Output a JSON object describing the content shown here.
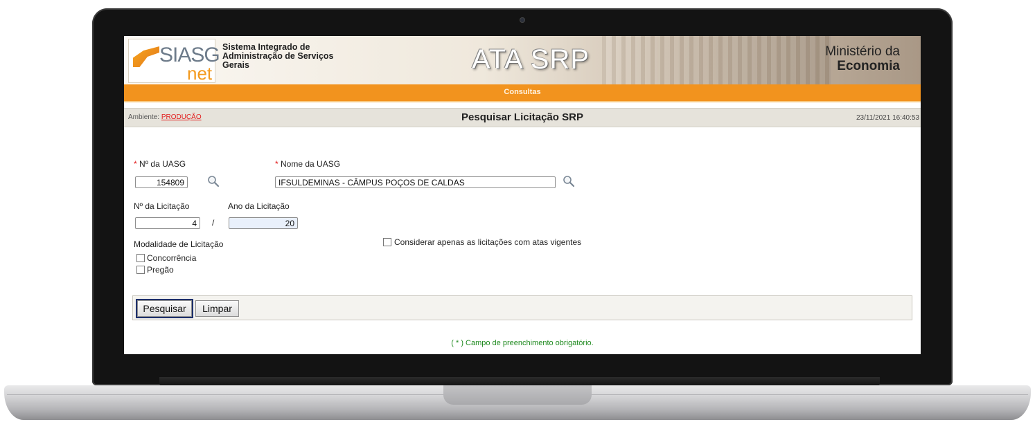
{
  "header": {
    "logo_text": "SIASG",
    "logo_sub": "net",
    "system_name": "Sistema Integrado de Administração de Serviços Gerais",
    "app_title": "ATA SRP",
    "ministry_line1": "Ministério da",
    "ministry_line2": "Economia"
  },
  "menu": {
    "item": "Consultas"
  },
  "titlebar": {
    "env_label": "Ambiente:",
    "env_value": "PRODUÇÃO",
    "page_title": "Pesquisar Licitação SRP",
    "datetime": "23/11/2021 16:40:53"
  },
  "form": {
    "required_mark": "*",
    "uasg_number_label": "Nº da UASG",
    "uasg_number_value": "154809",
    "uasg_name_label": "Nome da UASG",
    "uasg_name_value": "IFSULDEMINAS - CÂMPUS POÇOS DE CALDAS",
    "licitacao_number_label": "Nº da Licitação",
    "licitacao_number_value": "4",
    "separator": "/",
    "licitacao_year_label": "Ano da Licitação",
    "licitacao_year_value": "20",
    "modalidade_label": "Modalidade de Licitação",
    "modalidade_options": [
      "Concorrência",
      "Pregão"
    ],
    "vigentes_label": "Considerar apenas as licitações com atas vigentes"
  },
  "buttons": {
    "search": "Pesquisar",
    "clear": "Limpar"
  },
  "footer_note": "( * ) Campo de preenchimento obrigatório."
}
